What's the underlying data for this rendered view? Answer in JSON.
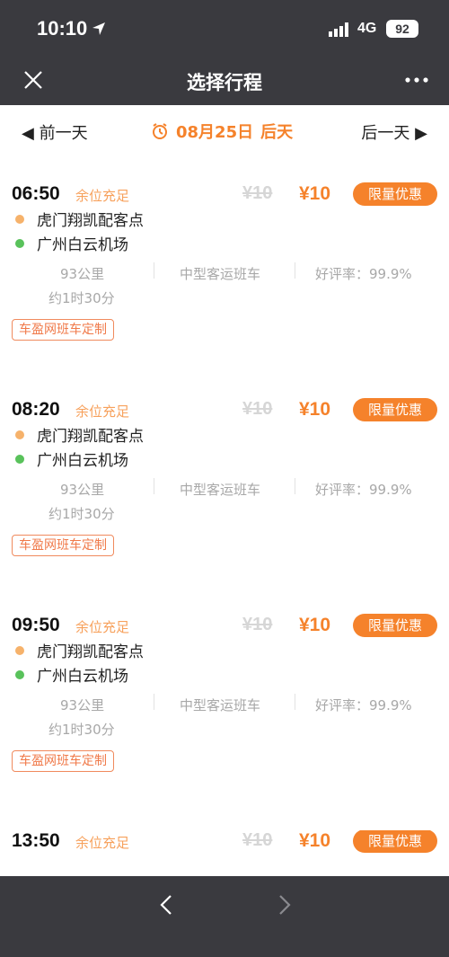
{
  "status_bar": {
    "time": "10:10",
    "network": "4G",
    "battery": "92"
  },
  "nav": {
    "title": "选择行程"
  },
  "date_bar": {
    "prev": "◀ 前一天",
    "date": "08月25日",
    "day": "后天",
    "next": "后一天 ▶"
  },
  "trips": [
    {
      "time": "06:50",
      "seat_status": "余位充足",
      "original_price": "¥10",
      "price": "¥10",
      "promo": "限量优惠",
      "from": "虎门翔凯配客点",
      "to": "广州白云机场",
      "distance": "93公里",
      "bus_type": "中型客运班车",
      "rating": "好评率：99.9%",
      "duration": "约1时30分",
      "tag": "车盈网班车定制"
    },
    {
      "time": "08:20",
      "seat_status": "余位充足",
      "original_price": "¥10",
      "price": "¥10",
      "promo": "限量优惠",
      "from": "虎门翔凯配客点",
      "to": "广州白云机场",
      "distance": "93公里",
      "bus_type": "中型客运班车",
      "rating": "好评率：99.9%",
      "duration": "约1时30分",
      "tag": "车盈网班车定制"
    },
    {
      "time": "09:50",
      "seat_status": "余位充足",
      "original_price": "¥10",
      "price": "¥10",
      "promo": "限量优惠",
      "from": "虎门翔凯配客点",
      "to": "广州白云机场",
      "distance": "93公里",
      "bus_type": "中型客运班车",
      "rating": "好评率：99.9%",
      "duration": "约1时30分",
      "tag": "车盈网班车定制"
    },
    {
      "time": "13:50",
      "seat_status": "余位充足",
      "original_price": "¥10",
      "price": "¥10",
      "promo": "限量优惠"
    }
  ],
  "colors": {
    "accent": "#f5822b",
    "dark_bar": "#3a3a3f"
  }
}
